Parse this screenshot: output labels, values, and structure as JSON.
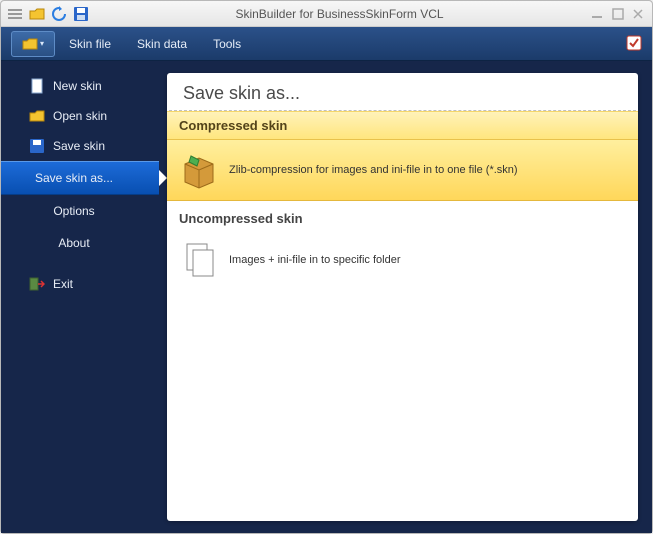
{
  "titlebar": {
    "title": "SkinBuilder for BusinessSkinForm VCL"
  },
  "menubar": {
    "items": [
      "Skin file",
      "Skin data",
      "Tools"
    ]
  },
  "sidebar": {
    "items": [
      {
        "label": "New skin"
      },
      {
        "label": "Open skin"
      },
      {
        "label": "Save skin"
      },
      {
        "label": "Save skin as..."
      },
      {
        "label": "Options"
      },
      {
        "label": "About"
      },
      {
        "label": "Exit"
      }
    ]
  },
  "panel": {
    "title": "Save skin as...",
    "sections": [
      {
        "header": "Compressed skin",
        "description": "Zlib-compression for images and ini-file in to one file (*.skn)"
      },
      {
        "header": "Uncompressed skin",
        "description": "Images + ini-file in to specific folder"
      }
    ]
  }
}
